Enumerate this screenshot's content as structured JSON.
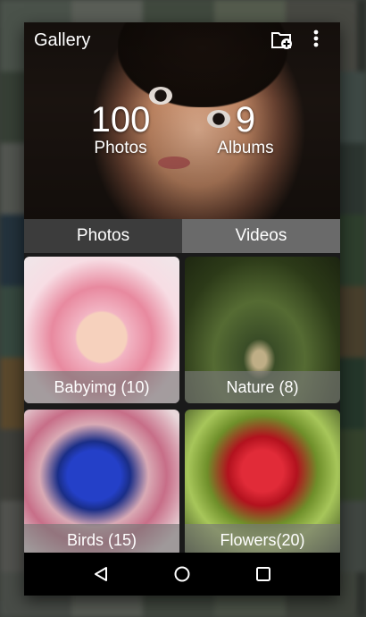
{
  "app": {
    "title": "Gallery"
  },
  "stats": {
    "photos": {
      "count": "100",
      "label": "Photos"
    },
    "albums": {
      "count": "9",
      "label": "Albums"
    }
  },
  "tabs": [
    {
      "label": "Photos",
      "active": true
    },
    {
      "label": "Videos",
      "active": false
    }
  ],
  "albums": [
    {
      "label": "Babyimg (10)"
    },
    {
      "label": "Nature (8)"
    },
    {
      "label": "Birds (15)"
    },
    {
      "label": "Flowers(20)"
    }
  ],
  "icons": {
    "toolbar": [
      "folder-add-icon",
      "more-vert-icon"
    ],
    "navbar": [
      "back-icon",
      "home-icon",
      "recents-icon"
    ]
  }
}
